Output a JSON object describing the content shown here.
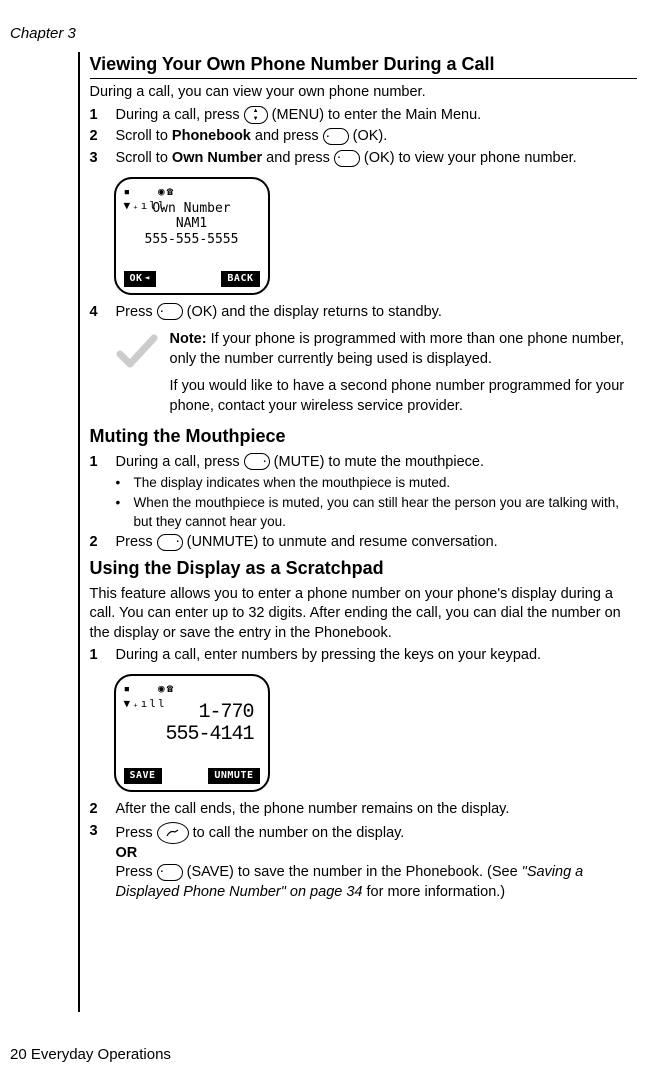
{
  "chapter": "Chapter 3",
  "section1": {
    "title": "Viewing Your Own Phone Number During a Call",
    "intro": "During a call, you can view your own phone number.",
    "step1": "During a call, press ",
    "step1b": " (MENU) to enter the Main Menu.",
    "step2a": "Scroll to ",
    "step2bold": "Phonebook",
    "step2b": " and press ",
    "step2c": " (OK).",
    "step3a": "Scroll to ",
    "step3bold": "Own Number",
    "step3b": " and press ",
    "step3c": " (OK) to view your phone number.",
    "step4": "Press ",
    "step4b": " (OK) and the display returns to standby."
  },
  "phone1": {
    "line1": "Own Number",
    "line2": "NAM1",
    "line3": "555-555-5555",
    "btn_left": "OK",
    "btn_right": "BACK"
  },
  "note": {
    "label": "Note:",
    "text1": " If your phone is programmed with more than one phone number, only the number currently being used is displayed.",
    "text2": "If you would like to have a second phone number programmed for your phone, contact your wireless service provider."
  },
  "section2": {
    "title": "Muting the Mouthpiece",
    "step1": "During a call, press ",
    "step1b": " (MUTE) to mute the mouthpiece.",
    "bullet1": "The display indicates when the mouthpiece is muted.",
    "bullet2": "When the mouthpiece is muted, you can still hear the person you are talking with, but they cannot hear you.",
    "step2": "Press ",
    "step2b": " (UNMUTE) to unmute and resume conversation."
  },
  "section3": {
    "title": "Using the Display as a Scratchpad",
    "intro": "This feature allows you to enter a phone number on your phone's display during a call. You can enter up to 32 digits. After ending the call, you can dial the number on the display or save the entry in the Phonebook.",
    "step1": "During a call, enter numbers by pressing the keys on your keypad.",
    "step2": "After the call ends, the phone number remains on the display.",
    "step3": "Press ",
    "step3b": " to call the number on the display.",
    "or": "OR",
    "step3c": "Press ",
    "step3d": " (SAVE) to save the number in the Phonebook. (See ",
    "step3ref": "\"Saving a Displayed Phone Number\" on page 34",
    "step3e": " for more information.)"
  },
  "phone2": {
    "line1": "1-770",
    "line2": "555-4141",
    "btn_left": "SAVE",
    "btn_right": "UNMUTE"
  },
  "footer": "20    Everyday Operations"
}
